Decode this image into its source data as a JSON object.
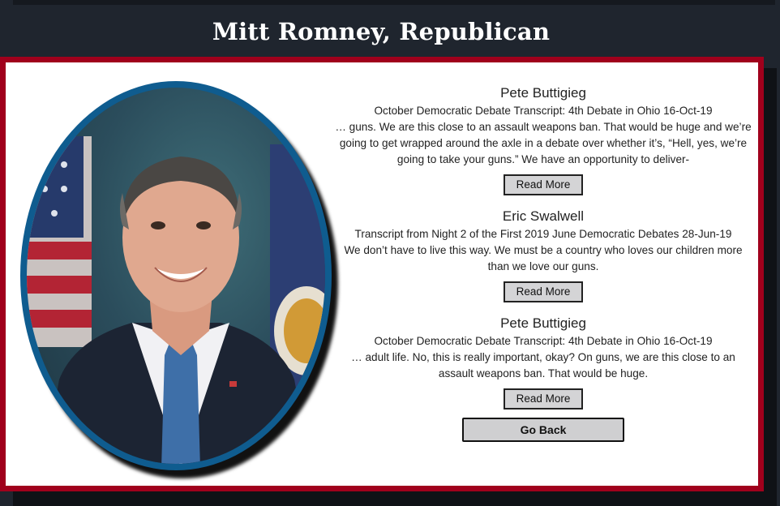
{
  "page": {
    "title": "Mitt Romney, Republican"
  },
  "portrait": {
    "border_color": "#0f5c8f",
    "frame_color": "#a0001c"
  },
  "quotes": [
    {
      "speaker": "Pete Buttigieg",
      "source": "October Democratic Debate Transcript: 4th Debate in Ohio 16-Oct-19",
      "text": "… guns. We are this close to an assault weapons ban. That would be huge and we’re going to get wrapped around the axle in a debate over whether it’s, “Hell, yes, we’re going to take your guns.” We have an opportunity to deliver-",
      "button_label": "Read More"
    },
    {
      "speaker": "Eric Swalwell",
      "source": "Transcript from Night 2 of the First 2019 June Democratic Debates 28-Jun-19",
      "text": "We don’t have to live this way. We must be a country who loves our children more than we love our guns.",
      "button_label": "Read More"
    },
    {
      "speaker": "Pete Buttigieg",
      "source": "October Democratic Debate Transcript: 4th Debate in Ohio 16-Oct-19",
      "text": "… adult life. No, this is really important, okay? On guns, we are this close to an assault weapons ban. That would be huge.",
      "button_label": "Read More"
    }
  ],
  "go_back_label": "Go Back"
}
